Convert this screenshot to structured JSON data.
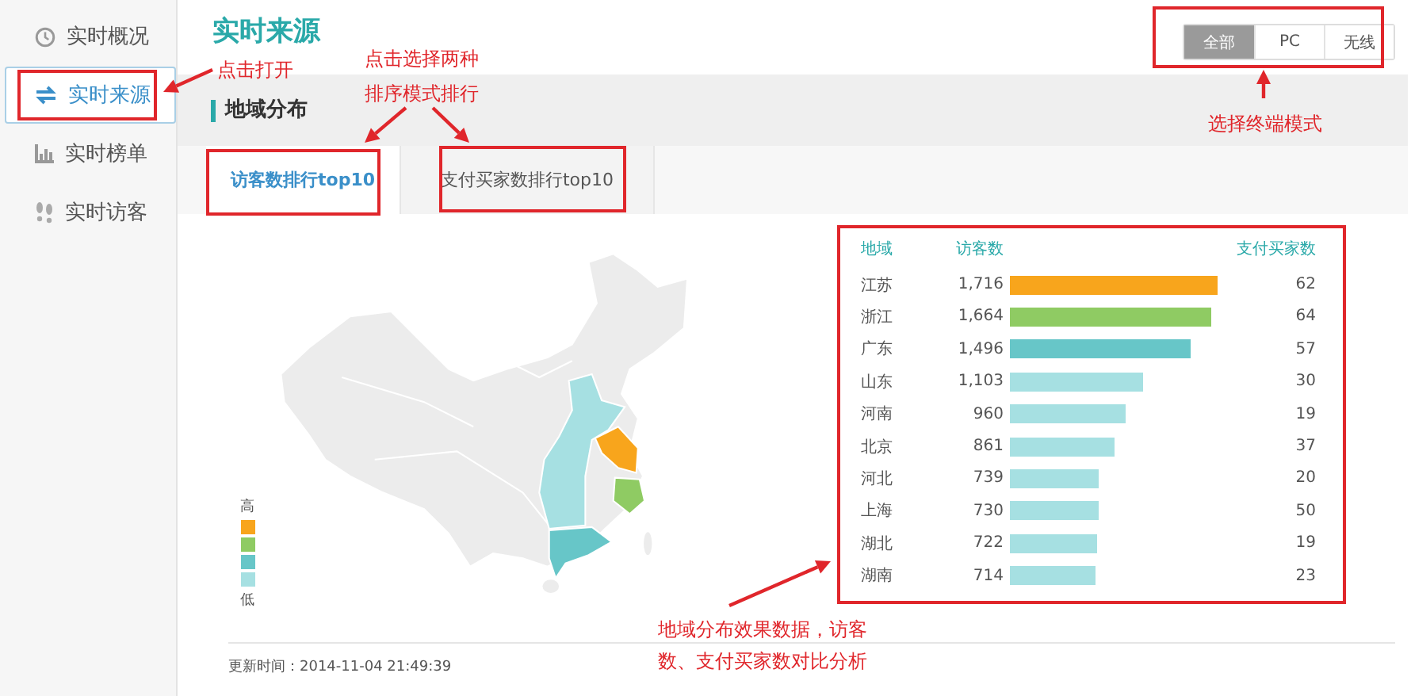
{
  "sidebar": {
    "items": [
      {
        "label": "实时概况",
        "selected": false
      },
      {
        "label": "实时来源",
        "selected": true
      },
      {
        "label": "实时榜单",
        "selected": false
      },
      {
        "label": "实时访客",
        "selected": false
      }
    ]
  },
  "page_title": "实时来源",
  "terminal_modes": [
    {
      "label": "全部",
      "selected": true
    },
    {
      "label": "PC",
      "selected": false
    },
    {
      "label": "无线",
      "selected": false
    }
  ],
  "section_title": "地域分布",
  "tabs": [
    {
      "label": "访客数排行top10",
      "selected": true
    },
    {
      "label": "支付买家数排行top10",
      "selected": false
    }
  ],
  "legend": {
    "high_label": "高",
    "low_label": "低",
    "items": [
      {
        "color": "#f8a51c"
      },
      {
        "color": "#8fcb63"
      },
      {
        "color": "#67c6c8"
      },
      {
        "color": "#a6e0e2"
      }
    ]
  },
  "table": {
    "columns": [
      "地域",
      "访客数",
      "支付买家数"
    ],
    "rows": [
      {
        "region": "江苏",
        "visitors": "1,716",
        "buyers": "62",
        "color": "#f8a51c"
      },
      {
        "region": "浙江",
        "visitors": "1,664",
        "buyers": "64",
        "color": "#8fcb63"
      },
      {
        "region": "广东",
        "visitors": "1,496",
        "buyers": "57",
        "color": "#67c6c8"
      },
      {
        "region": "山东",
        "visitors": "1,103",
        "buyers": "30",
        "color": "#a6e0e2"
      },
      {
        "region": "河南",
        "visitors": "960",
        "buyers": "19",
        "color": "#a6e0e2"
      },
      {
        "region": "北京",
        "visitors": "861",
        "buyers": "37",
        "color": "#a6e0e2"
      },
      {
        "region": "河北",
        "visitors": "739",
        "buyers": "20",
        "color": "#a6e0e2"
      },
      {
        "region": "上海",
        "visitors": "730",
        "buyers": "50",
        "color": "#a6e0e2"
      },
      {
        "region": "湖北",
        "visitors": "722",
        "buyers": "19",
        "color": "#a6e0e2"
      },
      {
        "region": "湖南",
        "visitors": "714",
        "buyers": "23",
        "color": "#a6e0e2"
      }
    ]
  },
  "updated": "更新时间：2014-11-04 21:49:39",
  "annotations": [
    {
      "text": "点击打开"
    },
    {
      "text": "点击选择两种"
    },
    {
      "text": "排序模式排行"
    },
    {
      "text": "选择终端模式"
    },
    {
      "text": "地域分布效果数据，访客"
    },
    {
      "text": "数、支付买家数对比分析"
    }
  ]
}
